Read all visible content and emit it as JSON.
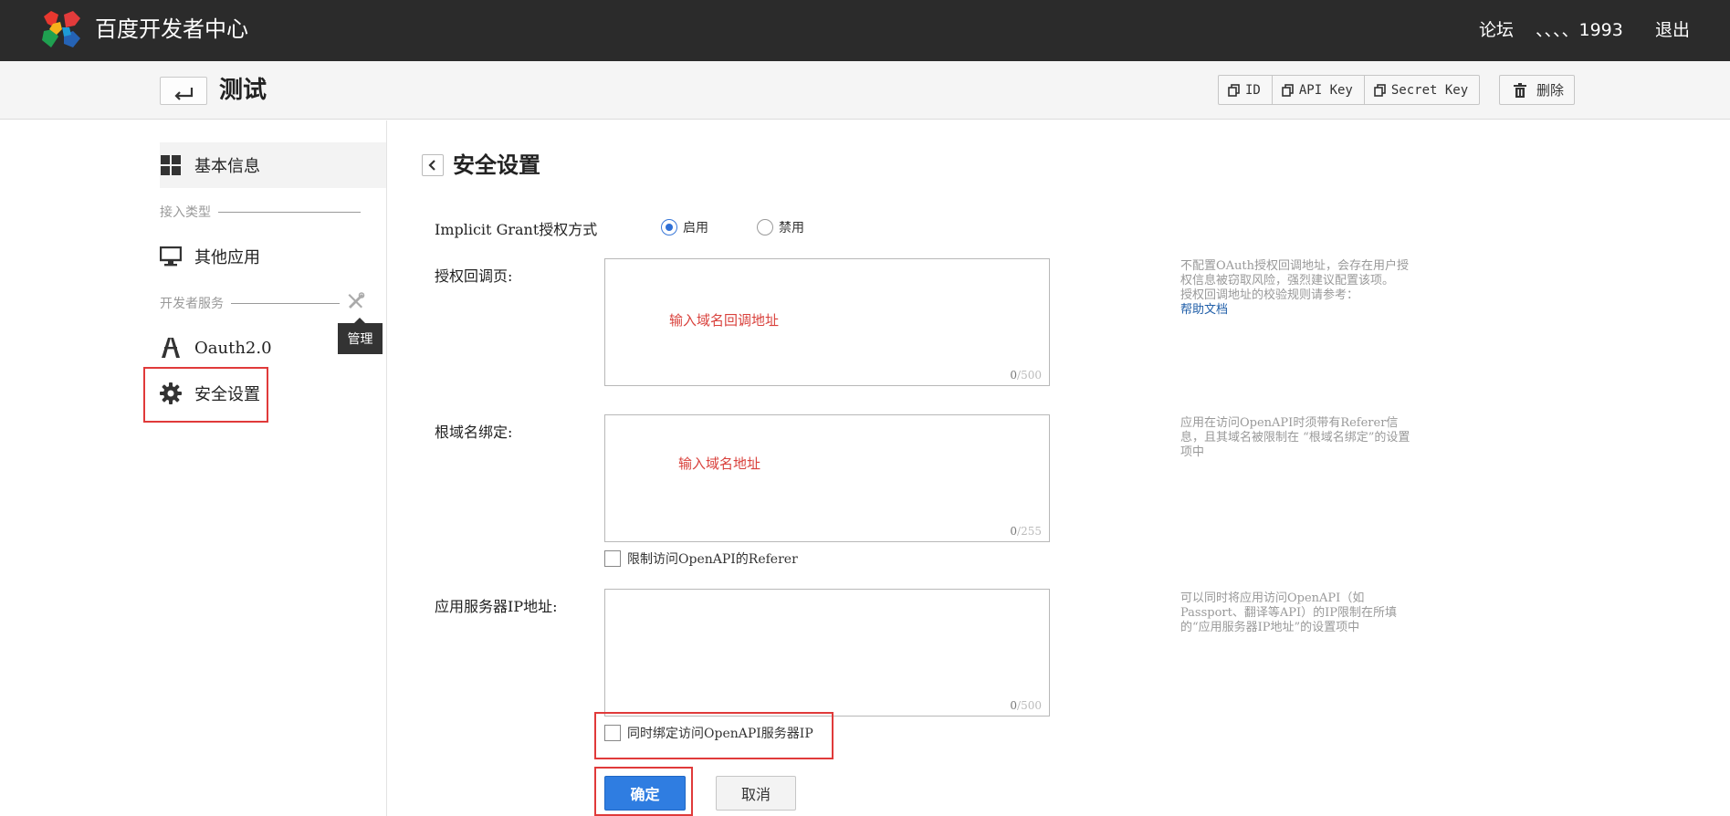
{
  "topbar": {
    "brand": "百度开发者中心",
    "links": {
      "forum": "论坛",
      "user": "、、、、1993",
      "logout": "退出"
    }
  },
  "header": {
    "title": "测试",
    "buttons": {
      "id": "ID",
      "api_key": "API Key",
      "secret_key": "Secret Key",
      "delete": "删除"
    }
  },
  "sidebar": {
    "basic_info": "基本信息",
    "section_access": "接入类型",
    "other_apps": "其他应用",
    "section_dev": "开发者服务",
    "tooltip": "管理",
    "oauth": "Oauth2.0",
    "security": "安全设置"
  },
  "main": {
    "title": "安全设置",
    "implicit": {
      "label": "Implicit Grant授权方式",
      "enable": "启用",
      "disable": "禁用",
      "selected": "启用"
    },
    "callback": {
      "label": "授权回调页:",
      "placeholder": "输入域名回调地址",
      "count": "0",
      "max": "/500",
      "hint": "不配置OAuth授权回调地址，会存在用户授权信息被窃取风险，强烈建议配置该项。",
      "hint2": "授权回调地址的校验规则请参考：",
      "help_link": "帮助文档"
    },
    "domain": {
      "label": "根域名绑定:",
      "placeholder": "输入域名地址",
      "count": "0",
      "max": "/255",
      "hint": "应用在访问OpenAPI时须带有Referer信息，且其域名被限制在 “根域名绑定”的设置项中",
      "checkbox": "限制访问OpenAPI的Referer"
    },
    "server_ip": {
      "label": "应用服务器IP地址:",
      "count": "0",
      "max": "/500",
      "hint": "可以同时将应用访问OpenAPI（如Passport、翻译等API）的IP限制在所填的“应用服务器IP地址”的设置项中",
      "checkbox": "同时绑定访问OpenAPI服务器IP"
    },
    "confirm": "确定",
    "cancel": "取消"
  },
  "colors": {
    "topbar": "#2b2b2b",
    "primary": "#2f7de1",
    "highlight": "#e03a3a",
    "link": "#1f5ea8"
  }
}
